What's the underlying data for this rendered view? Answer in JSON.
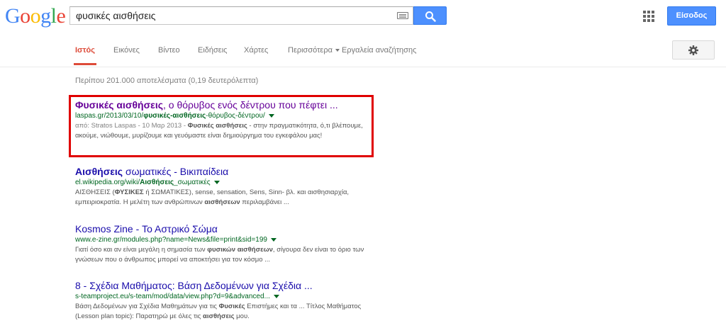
{
  "logo": {
    "letters": [
      {
        "ch": "G",
        "color": "#4285f4"
      },
      {
        "ch": "o",
        "color": "#ea4335"
      },
      {
        "ch": "o",
        "color": "#fbbc05"
      },
      {
        "ch": "g",
        "color": "#4285f4"
      },
      {
        "ch": "l",
        "color": "#34a853"
      },
      {
        "ch": "e",
        "color": "#ea4335"
      }
    ]
  },
  "search": {
    "value": "φυσικές αισθήσεις"
  },
  "header": {
    "signin_label": "Είσοδος"
  },
  "nav": {
    "tabs": [
      "Ιστός",
      "Εικόνες",
      "Βίντεο",
      "Ειδήσεις",
      "Χάρτες",
      "Περισσότερα",
      "Εργαλεία αναζήτησης"
    ],
    "active": 0
  },
  "stats": "Περίπου 201.000 αποτελέσματα (0,19 δευτερόλεπτα)",
  "results": [
    {
      "title_b": "Φυσικές αισθήσεις",
      "title_rest": ", ο θόρυβος ενός δέντρου που πέφτει ...",
      "url_pre": "laspas.gr/2013/03/10/",
      "url_b": "φυσικές-αισθήσεις",
      "url_post": "-θόρυβος-δέντρου/",
      "date": "από: Stratos Laspas - 10 Μαρ 2013 - ",
      "snip_b1": "Φυσικές αισθήσεις",
      "snip_1": " - στην πραγματικότητα, ό,τι βλέπουμε, ακούμε, νιώθουμε, μυρίζουμε και γευόμαστε είναι δημιούργημα του εγκεφάλου μας!"
    },
    {
      "title_b": "Αισθήσεις",
      "title_rest": " σωματικές - Βικιπαίδεια",
      "url_pre": "el.wikipedia.org/wiki/",
      "url_b": "Αισθήσεις",
      "url_post": "_σωματικές",
      "snip_1": "ΑΙΣΘΗΣΕΙΣ (",
      "snip_b1": "ΦΥΣΙΚΕΣ",
      "snip_2": " ή ΣΩΜΑΤΙΚΕΣ), sense, sensation, Sens, Sinn- βλ. και αισθησιαρχία, εμπειριοκρατία. Η μελέτη των ανθρώπινων ",
      "snip_b2": "αισθήσεων",
      "snip_3": " περιλαμβάνει ..."
    },
    {
      "title": "Kosmos Zine - Το Αστρικό Σώμα",
      "url": "www.e-zine.gr/modules.php?name=News&file=print&sid=199",
      "snip_1": "Γιατί όσο και αν είναι μεγάλη η σημασία των ",
      "snip_b1": "φυσικών αισθήσεων",
      "snip_2": ", σίγουρα δεν είναι το όριο των γνώσεων που ο άνθρωπος μπορεί να αποκτήσει για τον κόσμο ..."
    },
    {
      "title": "8 - Σχέδια Μαθήματος: Βάση Δεδομένων για Σχέδια ...",
      "url": "s-teamproject.eu/s-team/mod/data/view.php?d=9&advanced...",
      "snip_1": "Βάση Δεδομένων για Σχέδια Μαθημάτων για τις ",
      "snip_b1": "Φυσικές",
      "snip_2": " Επιστήμες και τα ... Τίτλος Μαθήματος (Lesson plan topic): Παρατηρώ με όλες τις ",
      "snip_b2": "αισθήσεις",
      "snip_3": " μου."
    }
  ]
}
